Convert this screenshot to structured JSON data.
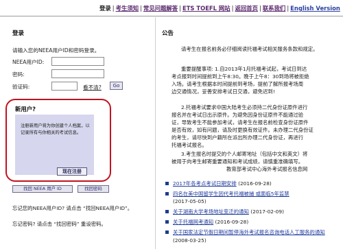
{
  "nav": {
    "items": [
      {
        "label": "登录"
      },
      {
        "label": "考生须知"
      },
      {
        "label": "常见问题解答"
      },
      {
        "label": "ETS TOEFL 网站"
      },
      {
        "label": "返回首页"
      },
      {
        "label": "联系我们"
      },
      {
        "label": "English Version"
      }
    ],
    "separator": "|"
  },
  "login": {
    "title": "登录",
    "prompt": "请输入您的NEEA用户ID和密码登录。",
    "user_id_label": "NEEA用户ID:",
    "password_label": "密码:",
    "captcha_label": "验证码:",
    "cant_see": "看不清?",
    "go_label": "Go",
    "user_id_value": "",
    "password_value": "",
    "captcha_value": ""
  },
  "new_user": {
    "title": "新用户?",
    "text": "注册新用户将为你创建个人档案，以记录所有与你相关的考试信息。",
    "register_label": "现在注册"
  },
  "find": {
    "find_id_label": "找回 NEEA 用户 ID",
    "find_password_label": "找回密码",
    "forgot_id": "忘记您的NEEA用户ID? 请点击 “找回NEEA用户ID”。",
    "forgot_password": "忘记密码? 请点击 “找回密码” 重设密码。"
  },
  "announcement": {
    "title": "公告",
    "intro": "请考生在报名前务必仔细阅读托福考试相关服务条款和规定。",
    "p1": [
      "重要提醒事项: 1.自2013年1月托福考试起，考试日到达",
      "考点报到时间提前到上午8:30。晚于上午8：30到场将被拒绝",
      "入场。请考生根据本时间提前到考场，提前了解所报考场周",
      "边交通情况，妥善安排考试日交通，避免迟到!"
    ],
    "p2": [
      "2.托福考试要求中国大陆考生必须持二代身份证原件进行",
      "报名并在考试日出示原件。为避免因身份证原件不能通过验",
      "证，导致考生不能参加考试，请考生在报名前检查身份证原件",
      "是否有效，如有问题，请及时更换有效证件。未办理二代身份证",
      "的考生，请尽快到户籍所在派出所办理二代身份证，再进行",
      "托福考试报名。"
    ],
    "p3": [
      "3.考生报名时提交的个人邮寄地址（包括中文和英文）将",
      "被用于向考生邮寄重要通知和考试成绩，请慎重准确填写。"
    ],
    "signature": "教育部考试中心海外考试报名信息网"
  },
  "news": [
    {
      "title": "2017年各考点考试日期安排",
      "date": "(2016-09-28)"
    },
    {
      "title": "四名在美中国留学生因代考托福被捕 或面临5年监禁",
      "date": "(2017-05-05)"
    },
    {
      "title": "关于湖南大学考场地址变迁的通知",
      "date": "(2017-02-09)"
    },
    {
      "title": "关于托福网考通知",
      "date": "(2016-09-28)"
    },
    {
      "title": "关于国家法定节假日期间暂停海外考试报名咨询电话人工服务的通知",
      "date": "(2008-03-25)"
    }
  ],
  "colors": {
    "nav_text": "#5a2a6e",
    "link": "#1f3a9e",
    "highlight_frame": "#c1121f",
    "new_user_card": "#d6d6ee"
  }
}
